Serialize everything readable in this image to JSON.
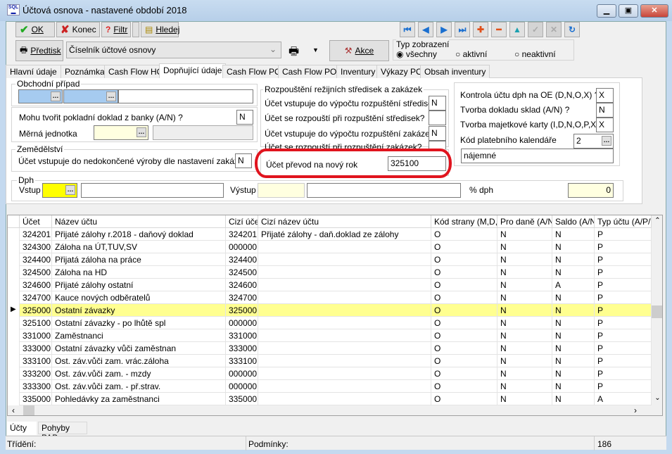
{
  "window": {
    "title": "Účtová osnova - nastavené období 2018",
    "logo": "SQL",
    "controls": [
      "minimize",
      "maximize",
      "close"
    ]
  },
  "toolbar": {
    "ok": "OK",
    "konec": "Konec",
    "filtr": "Filtr",
    "hledej": "Hledej",
    "predtisk": "Předtisk",
    "report_combo": "Číselník účtové osnovy",
    "akce": "Akce",
    "nav_icons": [
      "first-icon",
      "prev-icon",
      "next-icon",
      "last-icon",
      "add-icon",
      "delete-icon",
      "edit-up-icon",
      "confirm-icon",
      "cancel-icon",
      "refresh-icon"
    ]
  },
  "view_type": {
    "label": "Typ zobrazení",
    "options": [
      "všechny",
      "aktivní",
      "neaktivní"
    ],
    "selected": "všechny"
  },
  "tabs": [
    "Hlavní údaje",
    "Poznámka",
    "Cash Flow HO",
    "Dopňující údaje",
    "Cash Flow PO",
    "Cash Flow POJ",
    "Inventury",
    "Výkazy PO",
    "Obsah inventury"
  ],
  "active_tab": "Dopňující údaje",
  "form": {
    "obchodni_pripad": {
      "label": "Obchodní případ"
    },
    "mohu_tvorit": {
      "label": "Mohu tvořit pokladní doklad z banky (A/N) ?",
      "value": "N"
    },
    "merna_jednotka": {
      "label": "Měrná jednotka"
    },
    "zemedelstvi": {
      "label": "Zemědělství",
      "question": "Účet vstupuje do nedokončené výroby dle nastavení zakázek?",
      "value": "N"
    },
    "rozpousteni": {
      "label": "Rozpouštění režijních středisek a zakázek",
      "items": [
        {
          "label": "Účet vstupuje do výpočtu rozpuštění středisek?",
          "value": "N"
        },
        {
          "label": "Účet se rozpouští při rozpuštění středisek?",
          "value": ""
        },
        {
          "label": "Účet vstupuje do výpočtu rozpuštění zakázek?",
          "value": "N"
        },
        {
          "label": "Účet se rozpouští při rozpuštění zakázek?",
          "value": ""
        }
      ]
    },
    "prevod": {
      "label": "Účet převod na nový rok",
      "value": "325100"
    },
    "right": {
      "kontrola": {
        "label": "Kontrola účtu dph na OE (D,N,O,X) ?",
        "value": "X"
      },
      "sklad": {
        "label": "Tvorba dokladu sklad  (A/N) ?",
        "value": "N"
      },
      "majetek": {
        "label": "Tvorba majetkové karty (I,D,N,O,P,X) ?",
        "value": "X"
      },
      "kalendar": {
        "label": "Kód platebního kalendáře",
        "value": "2",
        "desc": "nájemné"
      }
    },
    "dph": {
      "label": "Dph",
      "vstup": "Vstup",
      "vystup": "Výstup",
      "pct_label": "% dph",
      "pct_value": "0"
    }
  },
  "highlight_color": "#e0141e",
  "grid": {
    "columns": [
      "Účet",
      "Název účtu",
      "Cizí účet",
      "Cizí název účtu",
      "Kód strany (M,D,O)",
      "Pro daně (A/N)",
      "Saldo (A/N)",
      "Typ účtu (A/P/V"
    ],
    "selected_row": 6,
    "rows": [
      [
        "324201",
        "Přijaté zálohy r.2018 - daňový doklad",
        "324201",
        "Přijaté zálohy - daň.doklad ze zálohy",
        "O",
        "N",
        "N",
        "P"
      ],
      [
        "324300",
        "Záloha na ÚT,TUV,SV",
        "000000",
        "",
        "O",
        "N",
        "N",
        "P"
      ],
      [
        "324400",
        "Přijatá záloha na práce",
        "324400",
        "",
        "O",
        "N",
        "N",
        "P"
      ],
      [
        "324500",
        "Záloha na HD",
        "324500",
        "",
        "O",
        "N",
        "N",
        "P"
      ],
      [
        "324600",
        "Přijaté zálohy ostatní",
        "324600",
        "",
        "O",
        "N",
        "A",
        "P"
      ],
      [
        "324700",
        "Kauce nových odběratelů",
        "324700",
        "",
        "O",
        "N",
        "N",
        "P"
      ],
      [
        "325000",
        "Ostatní závazky",
        "325000",
        "",
        "O",
        "N",
        "N",
        "P"
      ],
      [
        "325100",
        "Ostatní závazky - po lhůtě spl",
        "000000",
        "",
        "O",
        "N",
        "N",
        "P"
      ],
      [
        "331000",
        "Zaměstnanci",
        "331000",
        "",
        "O",
        "N",
        "N",
        "P"
      ],
      [
        "333000",
        "Ostatní závazky vůči zaměstnan",
        "333000",
        "",
        "O",
        "N",
        "N",
        "P"
      ],
      [
        "333100",
        "Ost. záv.vůči zam. vrác.záloha",
        "333100",
        "",
        "O",
        "N",
        "N",
        "P"
      ],
      [
        "333200",
        "Ost. záv.vůči zam. - mzdy",
        "000000",
        "",
        "O",
        "N",
        "N",
        "P"
      ],
      [
        "333300",
        "Ost. záv.vůči zam. - př.strav.",
        "000000",
        "",
        "O",
        "N",
        "N",
        "P"
      ],
      [
        "335000",
        "Pohledávky za zaměstnanci",
        "335000",
        "",
        "O",
        "N",
        "N",
        "A"
      ]
    ]
  },
  "bottom_tabs": [
    "Účty",
    "Pohyby PAP"
  ],
  "status": {
    "trideni": "Třídění:",
    "podminky": "Podmínky:",
    "count": "186"
  }
}
